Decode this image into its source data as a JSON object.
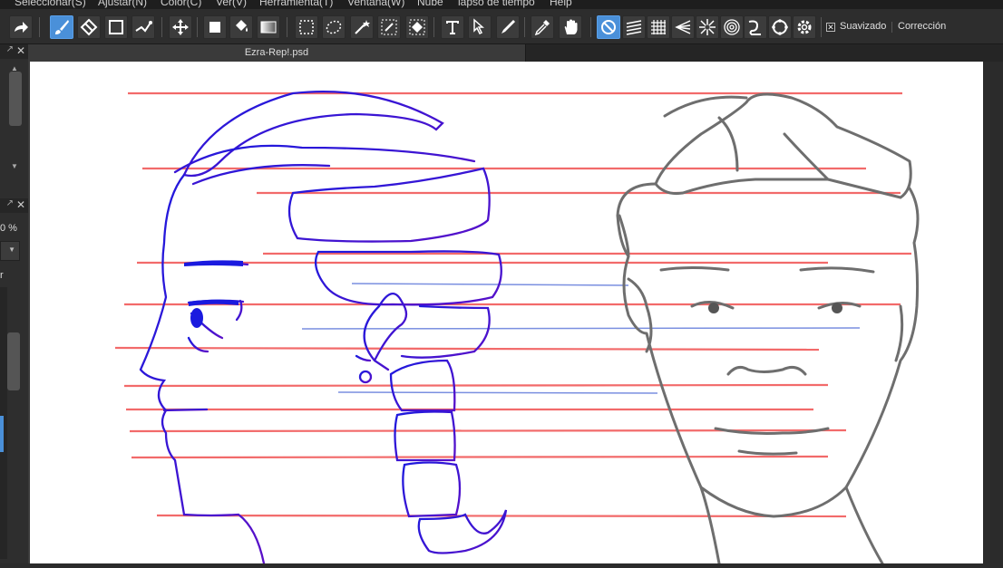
{
  "menu": {
    "items": [
      "Seleccionar(S)",
      "Ajustar(N)",
      "Color(C)",
      "Ver(V)",
      "Herramienta(T)",
      "Ventana(W)",
      "Nube",
      "lapso de tiempo",
      "Help"
    ]
  },
  "toolbar": {
    "smoothing_label": "Suavizado",
    "correction_label": "Corrección",
    "smoothing_checked": "✕",
    "accent_color": "#4a90d9"
  },
  "document": {
    "tab_title": "Ezra-Rep!.psd"
  },
  "left_panel": {
    "zoom_value": "0 %",
    "label_r": "r"
  },
  "icons": {
    "toolbar": [
      "redo-icon",
      "brush-icon",
      "eraser-icon",
      "rectangle-icon",
      "correction-pen-icon",
      "move-icon",
      "fill-rect-icon",
      "bucket-icon",
      "gradient-icon",
      "rect-select-icon",
      "lasso-icon",
      "magic-wand-icon",
      "select-pen-icon",
      "select-eraser-icon",
      "text-icon",
      "operation-icon",
      "eyedropper-brush-icon",
      "eyedropper-icon",
      "hand-icon",
      "snap-off-icon",
      "parallel-icon",
      "grid-icon",
      "vanishing-icon",
      "radial-icon",
      "concentric-icon",
      "curve-icon",
      "circle-icon",
      "settings-icon"
    ]
  }
}
